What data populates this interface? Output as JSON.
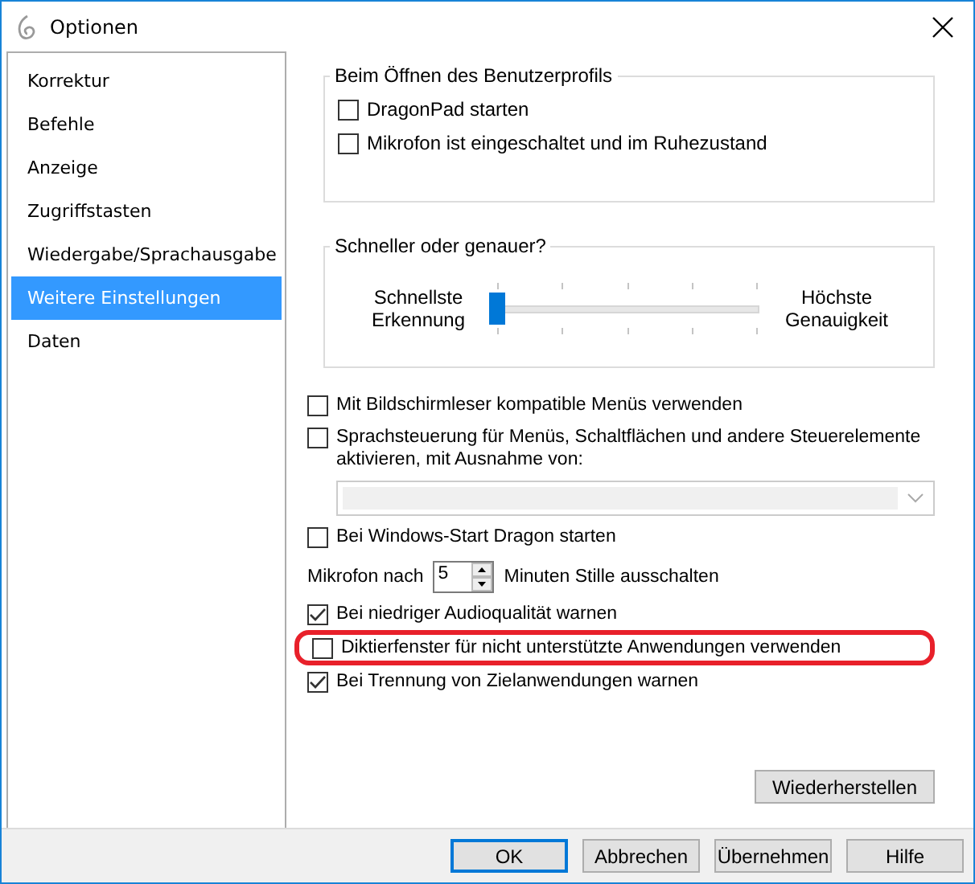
{
  "window": {
    "title": "Optionen"
  },
  "sidebar": {
    "items": [
      {
        "label": "Korrektur",
        "selected": false
      },
      {
        "label": "Befehle",
        "selected": false
      },
      {
        "label": "Anzeige",
        "selected": false
      },
      {
        "label": "Zugriffstasten",
        "selected": false
      },
      {
        "label": "Wiedergabe/Sprachausgabe",
        "selected": false
      },
      {
        "label": "Weitere Einstellungen",
        "selected": true
      },
      {
        "label": "Daten",
        "selected": false
      }
    ]
  },
  "profile_group": {
    "title": "Beim Öffnen des Benutzerprofils",
    "options": [
      {
        "label": "DragonPad starten",
        "checked": false
      },
      {
        "label": "Mikrofon ist eingeschaltet und im Ruhezustand",
        "checked": false
      }
    ]
  },
  "speed_group": {
    "title": "Schneller oder genauer?",
    "left_label": "Schnellste Erkennung",
    "right_label": "Höchste Genauigkeit",
    "level": 0
  },
  "options": [
    {
      "kind": "checkbox",
      "label": "Mit Bildschirmleser kompatible Menüs verwenden",
      "checked": false,
      "highlighted": false
    },
    {
      "kind": "checkbox",
      "label": "Sprachsteuerung für Menüs, Schaltflächen und andere Steuerelemente aktivieren, mit Ausnahme von:",
      "checked": false,
      "highlighted": false
    },
    {
      "kind": "dropdown",
      "disabled": true
    },
    {
      "kind": "checkbox",
      "label": "Bei Windows-Start Dragon starten",
      "checked": false,
      "highlighted": false
    },
    {
      "kind": "spinner",
      "prefix": "Mikrofon nach",
      "value": "5",
      "suffix": "Minuten Stille ausschalten"
    },
    {
      "kind": "checkbox",
      "label": "Bei niedriger Audioqualität warnen",
      "checked": true,
      "highlighted": false
    },
    {
      "kind": "checkbox",
      "label": "Diktierfenster für nicht unterstützte Anwendungen verwenden",
      "checked": false,
      "highlighted": true
    },
    {
      "kind": "checkbox",
      "label": "Bei Trennung von Zielanwendungen warnen",
      "checked": true,
      "highlighted": false
    }
  ],
  "restore_button": "Wiederherstellen",
  "buttons": [
    {
      "label": "OK",
      "default": true
    },
    {
      "label": "Abbrechen",
      "default": false
    },
    {
      "label": "Übernehmen",
      "default": false
    },
    {
      "label": "Hilfe",
      "default": false
    }
  ]
}
